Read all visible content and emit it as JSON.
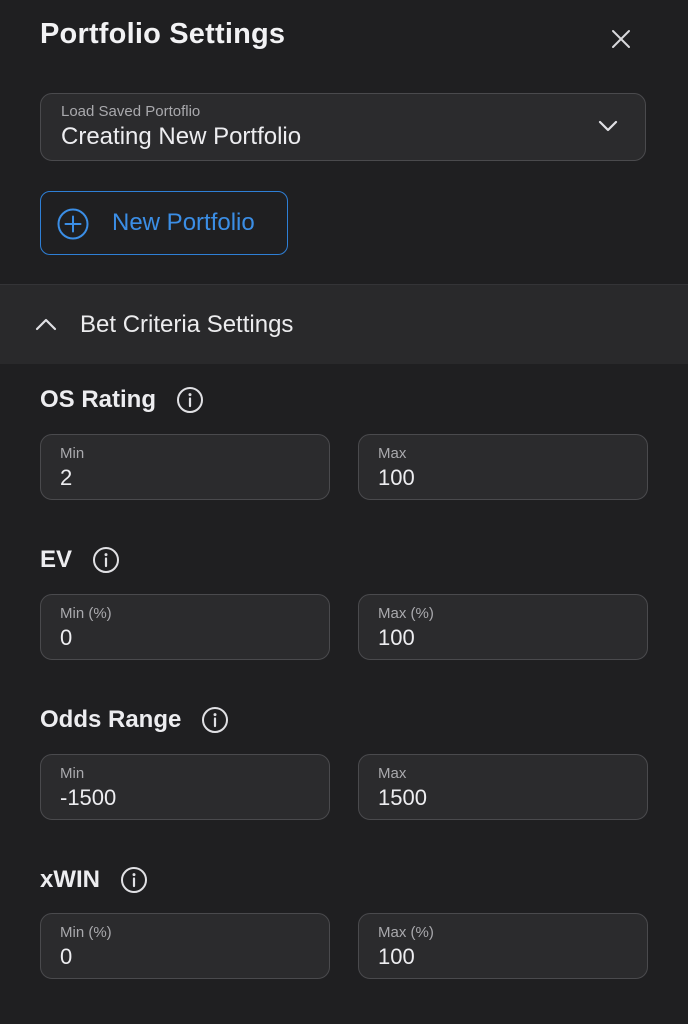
{
  "header": {
    "title": "Portfolio Settings",
    "close_icon": "close-icon"
  },
  "load_portfolio": {
    "label": "Load Saved Portoflio",
    "value": "Creating New Portfolio",
    "icon": "chevron-down-icon"
  },
  "new_portfolio": {
    "label": "New Portfolio",
    "icon": "plus-circle-icon",
    "color": "#3b8ee6"
  },
  "bet_criteria": {
    "label": "Bet Criteria Settings",
    "icon": "chevron-up-icon",
    "expanded": true
  },
  "groups": [
    {
      "label": "OS Rating",
      "min_label": "Min",
      "min_value": "2",
      "max_label": "Max",
      "max_value": "100"
    },
    {
      "label": "EV",
      "min_label": "Min (%)",
      "min_value": "0",
      "max_label": "Max (%)",
      "max_value": "100"
    },
    {
      "label": "Odds Range",
      "min_label": "Min",
      "min_value": "-1500",
      "max_label": "Max",
      "max_value": "1500"
    },
    {
      "label": "xWIN",
      "min_label": "Min (%)",
      "min_value": "0",
      "max_label": "Max (%)",
      "max_value": "100"
    }
  ],
  "colors": {
    "background": "#1f1f21",
    "field_background": "#2b2b2d",
    "accent": "#2e7fd6"
  }
}
